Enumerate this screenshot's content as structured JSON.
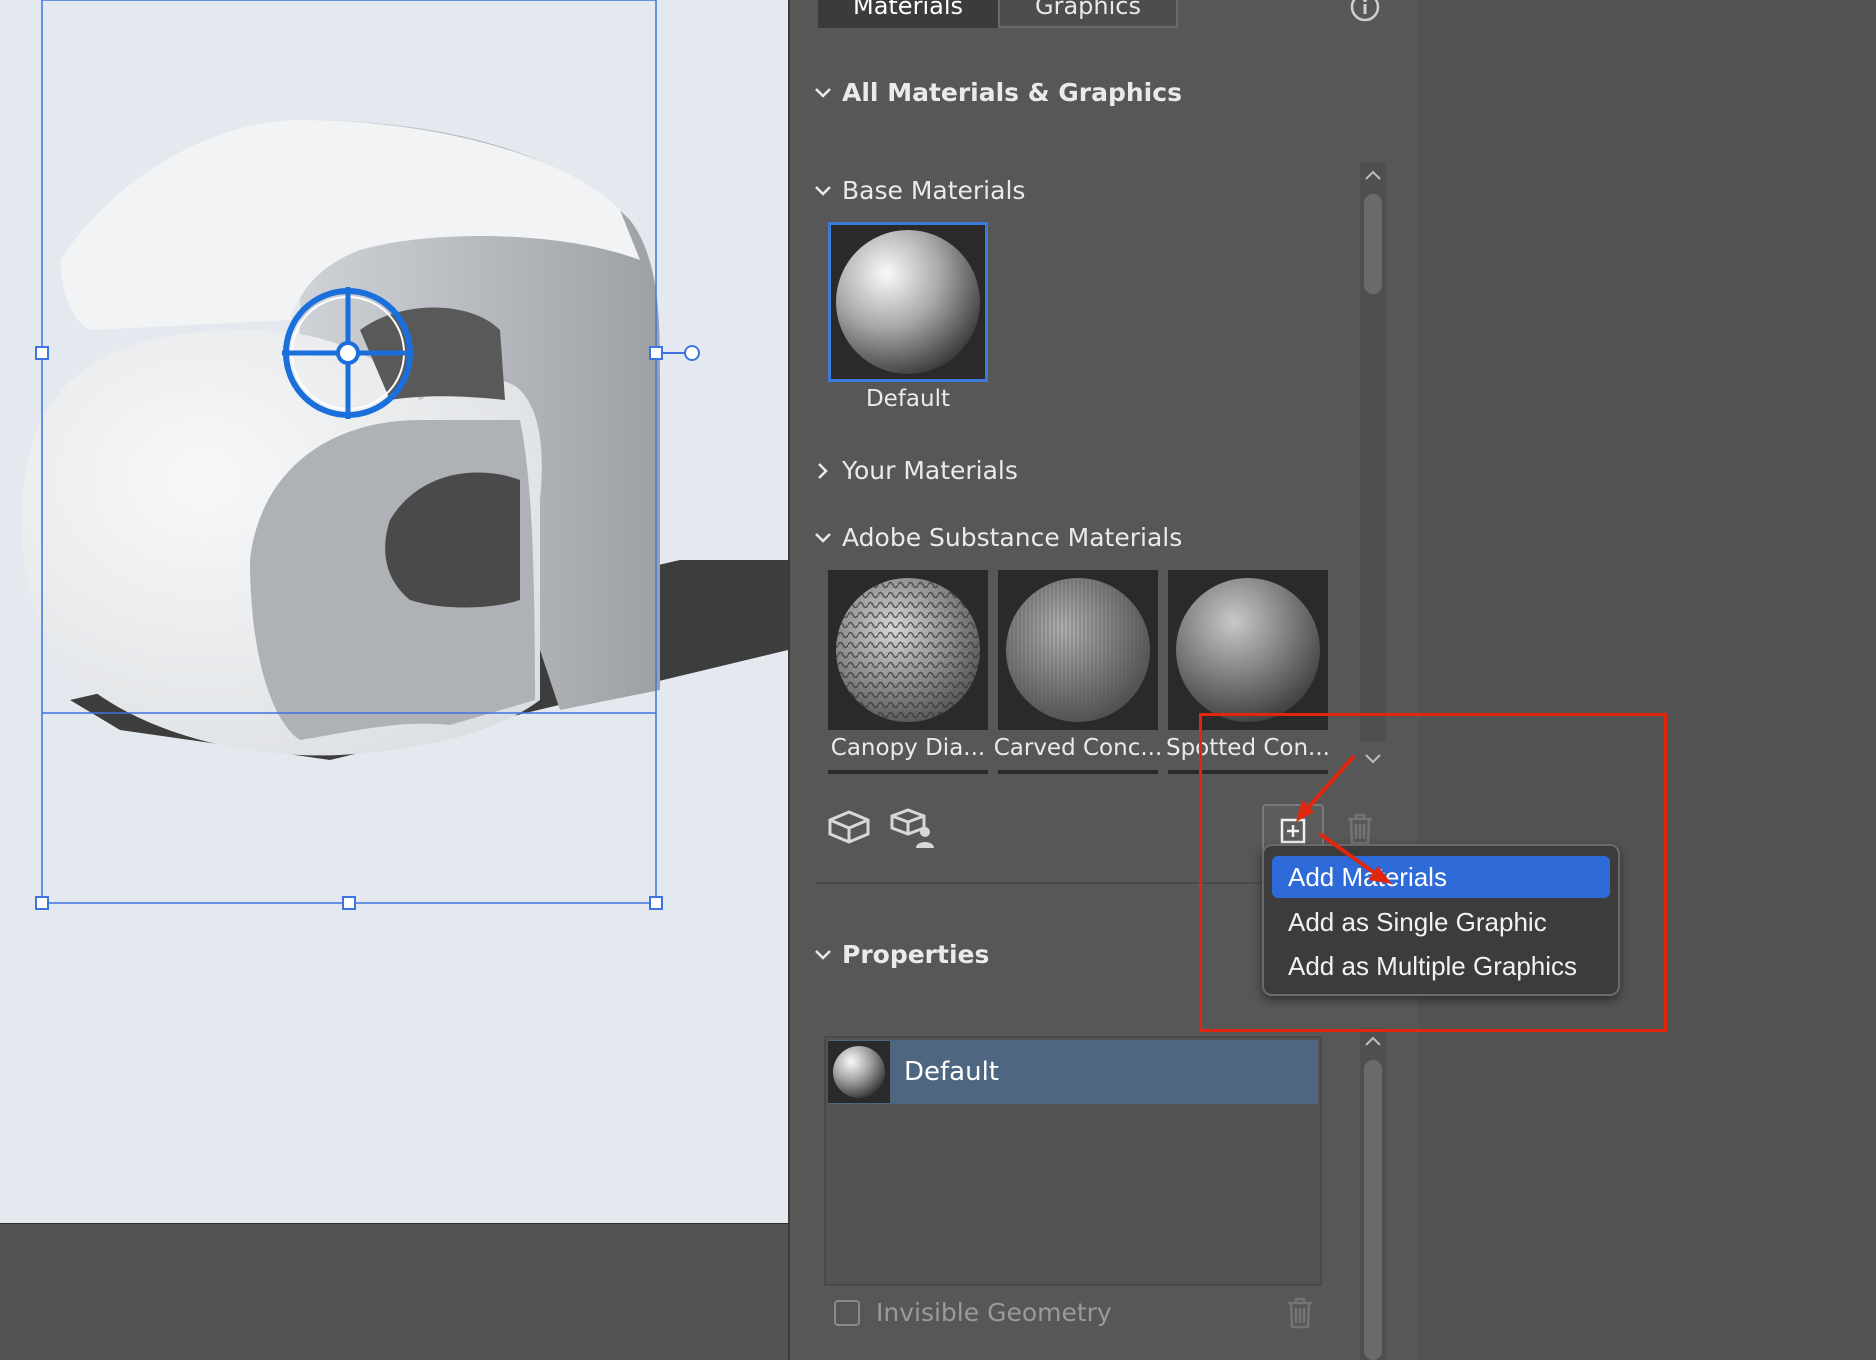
{
  "tabs": [
    {
      "label": "Materials",
      "active": true
    },
    {
      "label": "Graphics",
      "active": false
    }
  ],
  "sections": {
    "all": "All Materials & Graphics",
    "base": "Base Materials",
    "yours": "Your Materials",
    "substance": "Adobe Substance Materials",
    "properties": "Properties"
  },
  "base_materials": [
    {
      "label": "Default",
      "selected": true
    }
  ],
  "substance_materials": [
    {
      "label": "Canopy Dia..."
    },
    {
      "label": "Carved Conc..."
    },
    {
      "label": "Spotted Con..."
    }
  ],
  "add_menu": {
    "items": [
      "Add Materials",
      "Add as Single Graphic",
      "Add as Multiple Graphics"
    ],
    "highlighted": "Add Materials"
  },
  "properties": {
    "selected_material": "Default",
    "invisible_geometry_label": "Invisible Geometry",
    "invisible_geometry_checked": false
  },
  "colors": {
    "selection_blue": "#2f6bd8",
    "annotation_red": "#e0260e",
    "canvas_bg": "#e4e9ef",
    "panel_bg": "#575757"
  },
  "icons": [
    "info-icon",
    "chevron-down-icon",
    "chevron-right-icon",
    "cube-icon",
    "cube-user-icon",
    "add-icon",
    "trash-icon",
    "scroll-up-icon",
    "scroll-down-icon"
  ]
}
